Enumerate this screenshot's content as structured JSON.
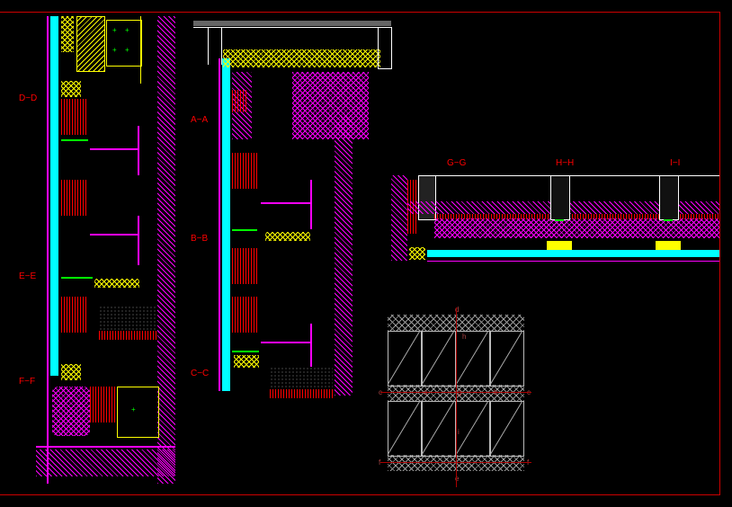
{
  "labels": {
    "dd": "D−D",
    "ee": "E−E",
    "ff": "F−F",
    "aa": "A−A",
    "bb": "B−B",
    "cc": "C−C",
    "gg": "G−G",
    "hh": "H−H",
    "ii": "I−I"
  },
  "drawing": {
    "type": "CAD architectural section details",
    "sections_left_column": [
      "D-D",
      "E-E",
      "F-F"
    ],
    "sections_mid_column": [
      "A-A",
      "B-B",
      "C-C"
    ],
    "sections_right_row": [
      "G-G",
      "H-H",
      "I-I"
    ],
    "has_elevation_key_plan": true,
    "colors": {
      "background": "#000000",
      "frame": "#cc0000",
      "hatch_primary": "#ff00ff",
      "hatch_secondary": "#ffff00",
      "glazing": "#00ffff",
      "outline": "#ffffff",
      "marker": "#00ff00",
      "insulation": "#ff0000",
      "elevation_lines": "#bbbbbb"
    }
  }
}
